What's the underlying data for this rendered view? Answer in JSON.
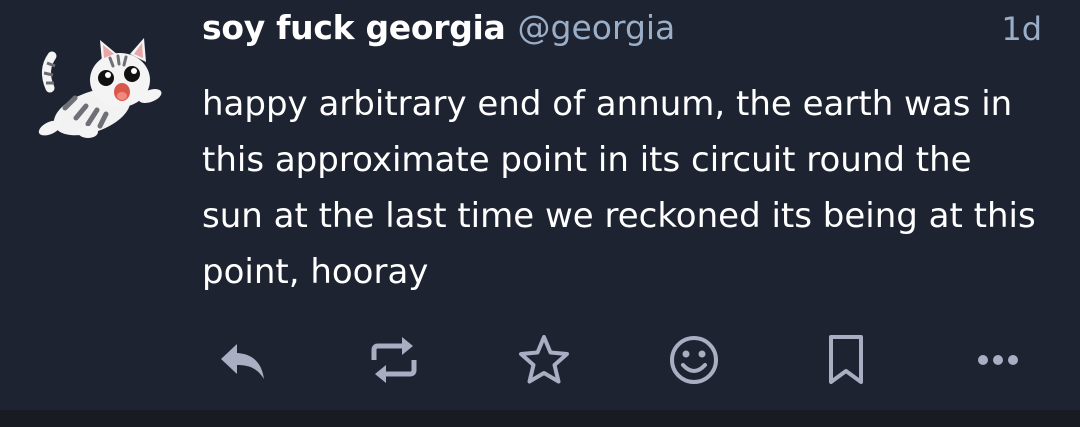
{
  "post": {
    "display_name": "soy fuck georgia",
    "handle": "@georgia",
    "relative_time": "1d",
    "content": "happy arbitrary end of annum, the earth was in this approximate point in its circuit round the sun at the last time we reckoned its being at this point, hooray"
  },
  "icons": {
    "avatar": "cartoon-cat-avatar",
    "actions": [
      "reply-icon",
      "boost-icon",
      "favourite-star-icon",
      "emoji-reaction-icon",
      "bookmark-icon",
      "more-options-icon"
    ]
  },
  "colors": {
    "background": "#1d2330",
    "text": "#ffffff",
    "muted": "#9baec8",
    "icon": "#a9aec2"
  }
}
